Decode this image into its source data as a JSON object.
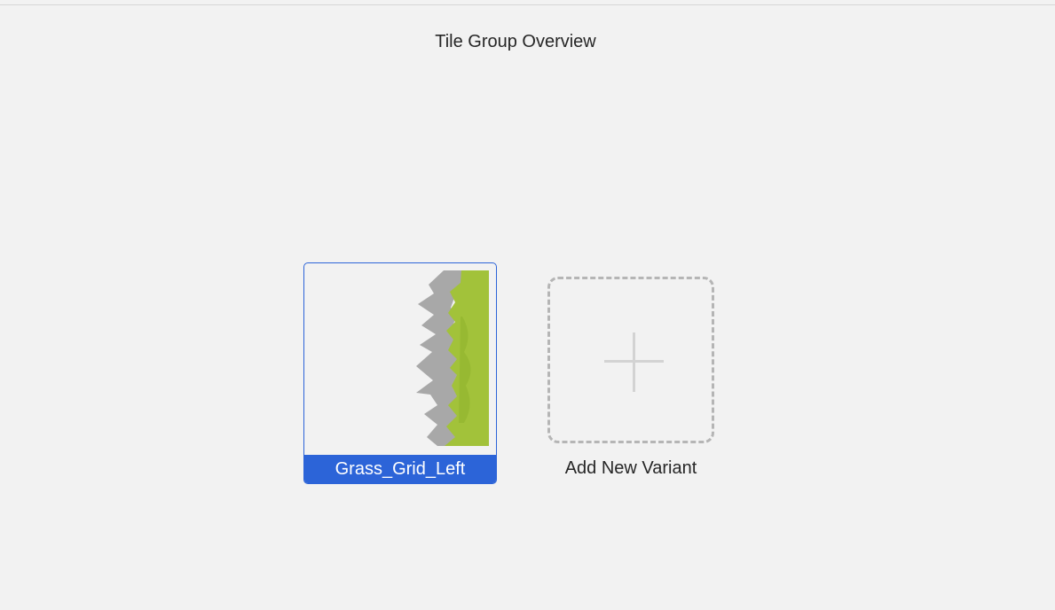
{
  "header": {
    "title": "Tile Group Overview"
  },
  "variants": [
    {
      "label": "Grass_Grid_Left",
      "selected": true,
      "thumbnail": "grass-edge-tile",
      "colors": {
        "grass": "#a2c23a",
        "grass_shade": "#93b52f",
        "edge": "#a8a8a8"
      }
    }
  ],
  "add_variant": {
    "label": "Add New Variant",
    "icon": "plus-icon"
  },
  "colors": {
    "background": "#f2f2f2",
    "accent": "#2c64d8",
    "dashed_border": "#b5b5b5"
  }
}
